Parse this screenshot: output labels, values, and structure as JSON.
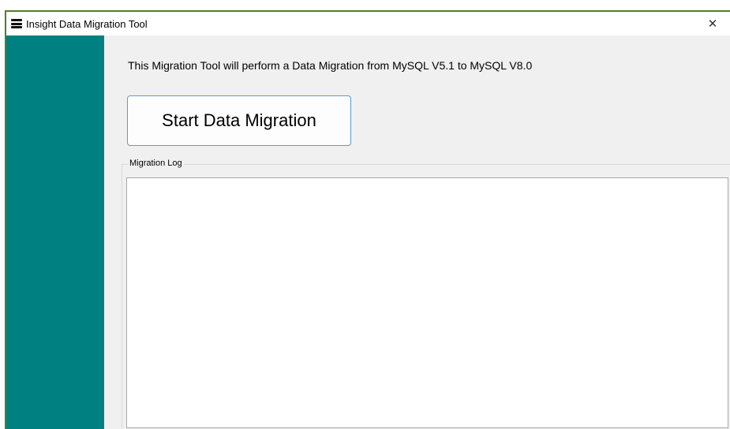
{
  "caption_fragment": "...",
  "window": {
    "title": "Insight Data Migration Tool",
    "close_glyph": "✕"
  },
  "main": {
    "description": "This Migration Tool will perform a Data Migration from MySQL V5.1 to MySQL V8.0",
    "start_button_label": "Start Data Migration",
    "log_group_label": "Migration Log",
    "log_text": ""
  },
  "colors": {
    "sidebar": "#008080",
    "window_border": "#4f7f2e",
    "button_border": "#5b9bd5",
    "background": "#f0f0f0"
  },
  "icons": {
    "app_icon": "hamburger-menu-icon",
    "close": "close-icon"
  }
}
